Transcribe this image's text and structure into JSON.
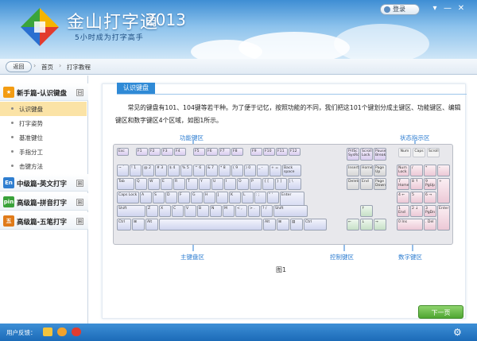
{
  "app": {
    "title": "金山打字通",
    "year": "2013",
    "slogan": "5小时成为打字高手",
    "login_label": "登录",
    "window_controls": [
      "▾",
      "—",
      "✕"
    ]
  },
  "nav": {
    "back_label": "返回",
    "breadcrumbs": [
      "首页",
      "打字教程"
    ]
  },
  "sidebar": {
    "sections": [
      {
        "badge": "★",
        "badge_color": "#f39c12",
        "title": "新手篇-认识键盘",
        "expander": "⊟",
        "items": [
          {
            "label": "认识键盘",
            "active": true
          },
          {
            "label": "打字姿势",
            "active": false
          },
          {
            "label": "基准键位",
            "active": false
          },
          {
            "label": "手指分工",
            "active": false
          },
          {
            "label": "击键方法",
            "active": false
          }
        ]
      },
      {
        "badge": "En",
        "badge_color": "#2f7ed0",
        "title": "中级篇-英文打字",
        "expander": "⊞",
        "items": []
      },
      {
        "badge": "pin",
        "badge_color": "#3aa23a",
        "title": "高级篇-拼音打字",
        "expander": "⊞",
        "items": []
      },
      {
        "badge": "五",
        "badge_color": "#e07b1a",
        "title": "高级篇-五笔打字",
        "expander": "⊞",
        "items": []
      }
    ]
  },
  "content": {
    "tab_title": "认识键盘",
    "paragraph": "常见的键盘有101、104键等若干种。为了便于记忆，按照功能的不同，我们把这101个键划分成主键区、功能键区、编辑键区和数字键区4个区域，如图1所示。",
    "labels": {
      "function_zone": "功能键区",
      "status_zone": "状态指示区",
      "main_zone": "主键盘区",
      "control_zone": "控制键区",
      "numeric_zone": "数字键区"
    },
    "figure_caption": "图1",
    "next_label": "下一页"
  },
  "keyboard": {
    "fn_row": [
      "Esc",
      "F1",
      "F2",
      "F3",
      "F4",
      "F5",
      "F6",
      "F7",
      "F8",
      "F9",
      "F10",
      "F11",
      "F12"
    ],
    "sys_keys": [
      "PrtSc SysRq",
      "Scroll Lock",
      "Pause Break"
    ],
    "status_lights": [
      "Num",
      "Caps",
      "Scroll"
    ],
    "row1": [
      "~ `",
      "! 1",
      "@ 2",
      "# 3",
      "$ 4",
      "% 5",
      "^ 6",
      "& 7",
      "* 8",
      "( 9",
      ") 0",
      "_ -",
      "+ =",
      "Back space"
    ],
    "row2": [
      "Tab",
      "Q",
      "W",
      "E",
      "R",
      "T",
      "Y",
      "U",
      "I",
      "O",
      "P",
      "{ [",
      "} ]",
      "| \\"
    ],
    "row3": [
      "Caps Lock",
      "A",
      "S",
      "D",
      "F",
      "G",
      "H",
      "J",
      "K",
      "L",
      ": ;",
      "\" '",
      "Enter"
    ],
    "row4": [
      "Shift",
      "Z",
      "X",
      "C",
      "V",
      "B",
      "N",
      "M",
      "< ,",
      "> .",
      "? /",
      "Shift"
    ],
    "row5": [
      "Ctrl",
      "⊞",
      "Alt",
      "",
      "Alt",
      "⊞",
      "▤",
      "Ctrl"
    ],
    "edit_keys": [
      "Insert",
      "Home",
      "Page Up",
      "Delete",
      "End",
      "Page Down"
    ],
    "arrow_keys": [
      "↑",
      "←",
      "↓",
      "→"
    ],
    "num_keys": [
      "Num Lock",
      "/",
      "*",
      "-",
      "7 Home",
      "8 ↑",
      "9 PgUp",
      "+",
      "4 ←",
      "5",
      "6 →",
      "1 End",
      "2 ↓",
      "3 PgDn",
      "Enter",
      "0 Ins",
      ". Del"
    ]
  },
  "status_bar": {
    "feedback_label": "用户反馈："
  },
  "colors": {
    "header_blue": "#3f8ed4",
    "accent_blue": "#2f8ad6",
    "next_green": "#4fa632",
    "active_item": "#fbe3a6"
  }
}
